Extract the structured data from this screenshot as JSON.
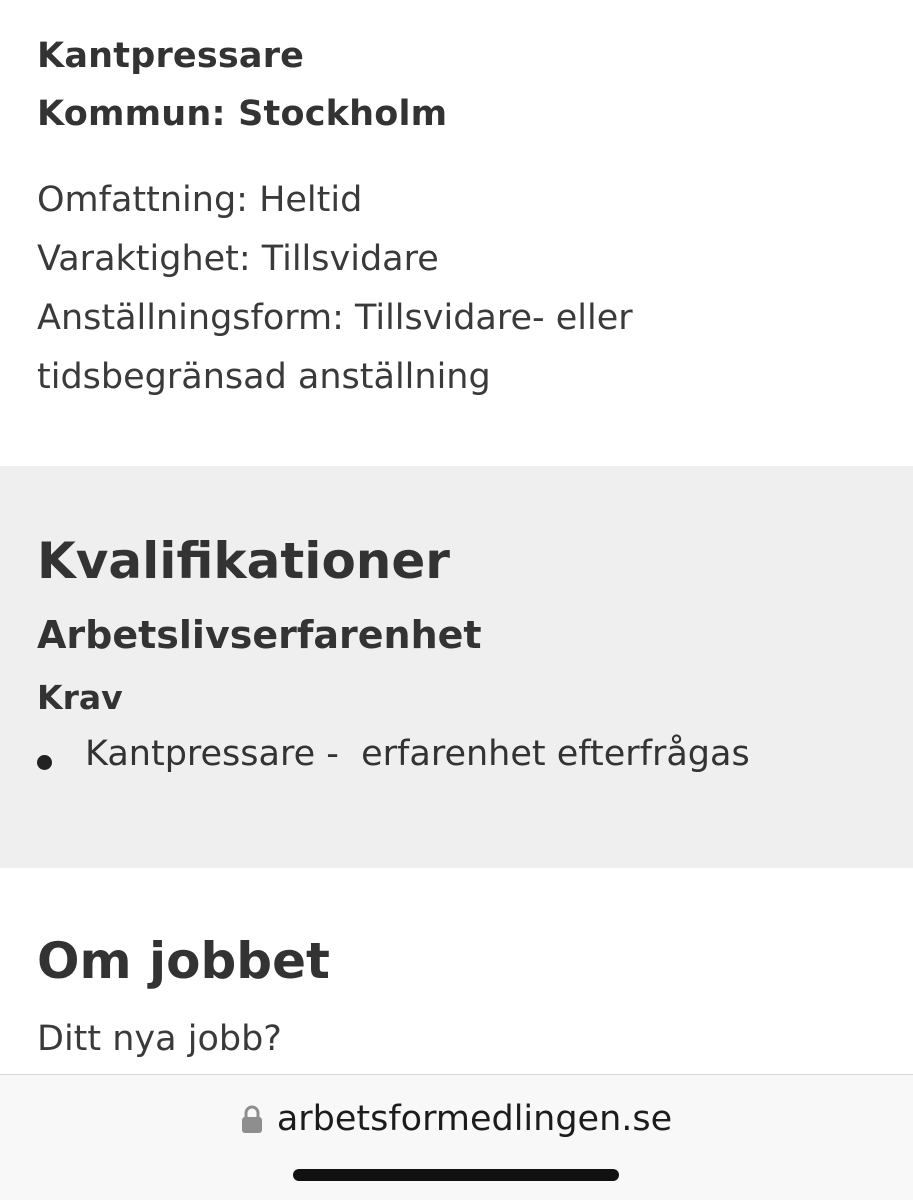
{
  "job": {
    "title": "Kantpressare",
    "municipality": "Kommun: Stockholm",
    "details": [
      "Omfattning: Heltid",
      "Varaktighet: Tillsvidare",
      "Anställningsform: Tillsvidare- eller",
      "tidsbegränsad anställning"
    ]
  },
  "qualifications": {
    "heading": "Kvalifikationer",
    "subheading": "Arbetslivserfarenhet",
    "requirement_label": "Krav",
    "items": [
      "Kantpressare -  erfarenhet efterfrågas"
    ]
  },
  "about": {
    "heading": "Om jobbet",
    "text": "Ditt nya jobb?"
  },
  "browser": {
    "url": "arbetsformedlingen.se",
    "lock_icon": "lock-icon"
  },
  "colors": {
    "text": "#333333",
    "section_gray": "#efefef",
    "browser_bar": "#f8f8f8"
  }
}
